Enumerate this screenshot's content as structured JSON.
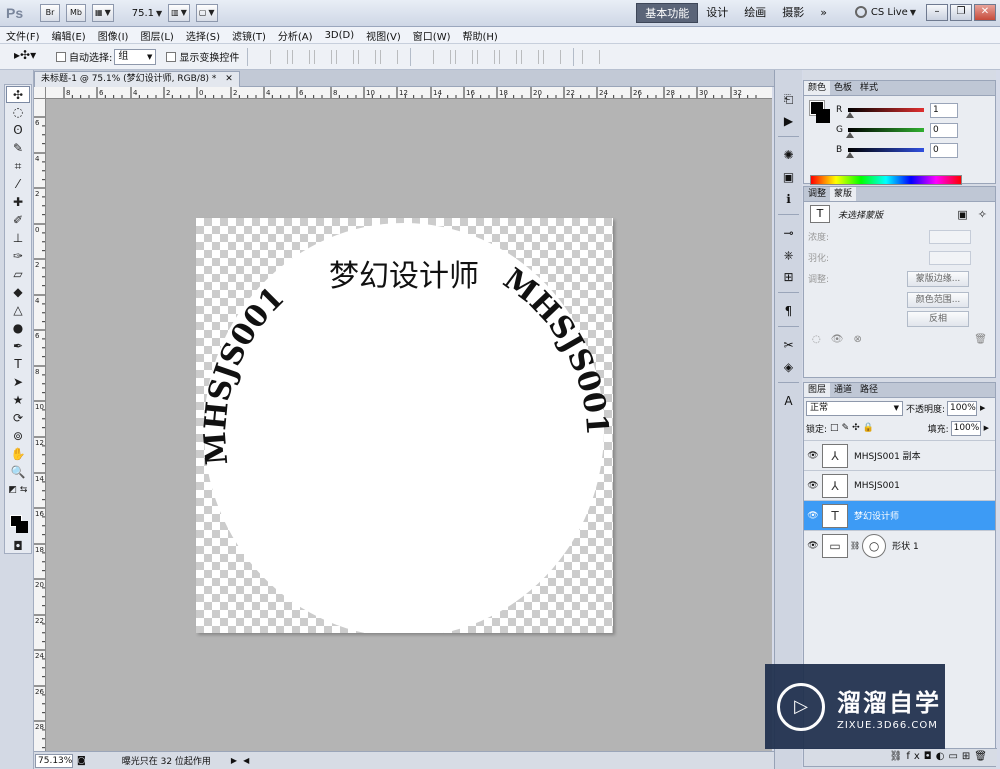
{
  "app": {
    "logo": "Ps",
    "buttons": [
      "Br",
      "Mb"
    ],
    "zoom": "75.1",
    "workspaces": [
      "基本功能",
      "设计",
      "绘画",
      "摄影"
    ],
    "more": "»",
    "cslive": "CS Live"
  },
  "menu": [
    "文件(F)",
    "编辑(E)",
    "图像(I)",
    "图层(L)",
    "选择(S)",
    "滤镜(T)",
    "分析(A)",
    "3D(D)",
    "视图(V)",
    "窗口(W)",
    "帮助(H)"
  ],
  "options": {
    "auto_select_label": "自动选择:",
    "auto_select_value": "组",
    "show_transform_label": "显示变换控件"
  },
  "document": {
    "tab_title": "未标题-1 @ 75.1% (梦幻设计师, RGB/8) *",
    "ruler_h": [
      "8",
      "6",
      "4",
      "2",
      "0",
      "2",
      "4",
      "6",
      "8",
      "10",
      "12",
      "14",
      "16",
      "18",
      "20",
      "22",
      "24",
      "26",
      "28",
      "30",
      "32"
    ],
    "ruler_v": [
      "6",
      "4",
      "2",
      "0",
      "2",
      "4",
      "6",
      "8",
      "10",
      "12",
      "14",
      "16",
      "18",
      "20",
      "22",
      "24",
      "26",
      "28"
    ],
    "arc_text": "MHSJS001 梦幻设计师 MHSJS001",
    "arc_left": "MHSJS001",
    "arc_center": "梦幻设计师",
    "arc_right": "MHSJS001"
  },
  "status": {
    "zoom": "75.13%",
    "text": "曝光只在 32 位起作用"
  },
  "color_panel": {
    "tabs": [
      "颜色",
      "色板",
      "样式"
    ],
    "channels": [
      {
        "label": "R",
        "value": "1",
        "color": "#e03030"
      },
      {
        "label": "G",
        "value": "0",
        "color": "#30b030"
      },
      {
        "label": "B",
        "value": "0",
        "color": "#3050e0"
      }
    ]
  },
  "mask_panel": {
    "tabs": [
      "调整",
      "蒙版"
    ],
    "title": "未选择蒙版",
    "rows": [
      "浓度:",
      "羽化:",
      "调整:"
    ],
    "buttons": [
      "蒙版边缘...",
      "颜色范围...",
      "反相"
    ]
  },
  "layers_panel": {
    "tabs": [
      "图层",
      "通道",
      "路径"
    ],
    "blend_mode": "正常",
    "opacity_label": "不透明度:",
    "opacity": "100%",
    "lock_label": "锁定:",
    "fill_label": "填充:",
    "fill": "100%",
    "layers": [
      {
        "name": "MHSJS001 副本",
        "thumb": "⅄",
        "selected": false
      },
      {
        "name": "MHSJS001",
        "thumb": "⅄",
        "selected": false
      },
      {
        "name": "梦幻设计师",
        "thumb": "T",
        "selected": true
      },
      {
        "name": "形状 1",
        "thumb": "○",
        "selected": false
      }
    ]
  },
  "watermark": {
    "title": "溜溜自学",
    "subtitle": "ZIXUE.3D66.COM"
  }
}
